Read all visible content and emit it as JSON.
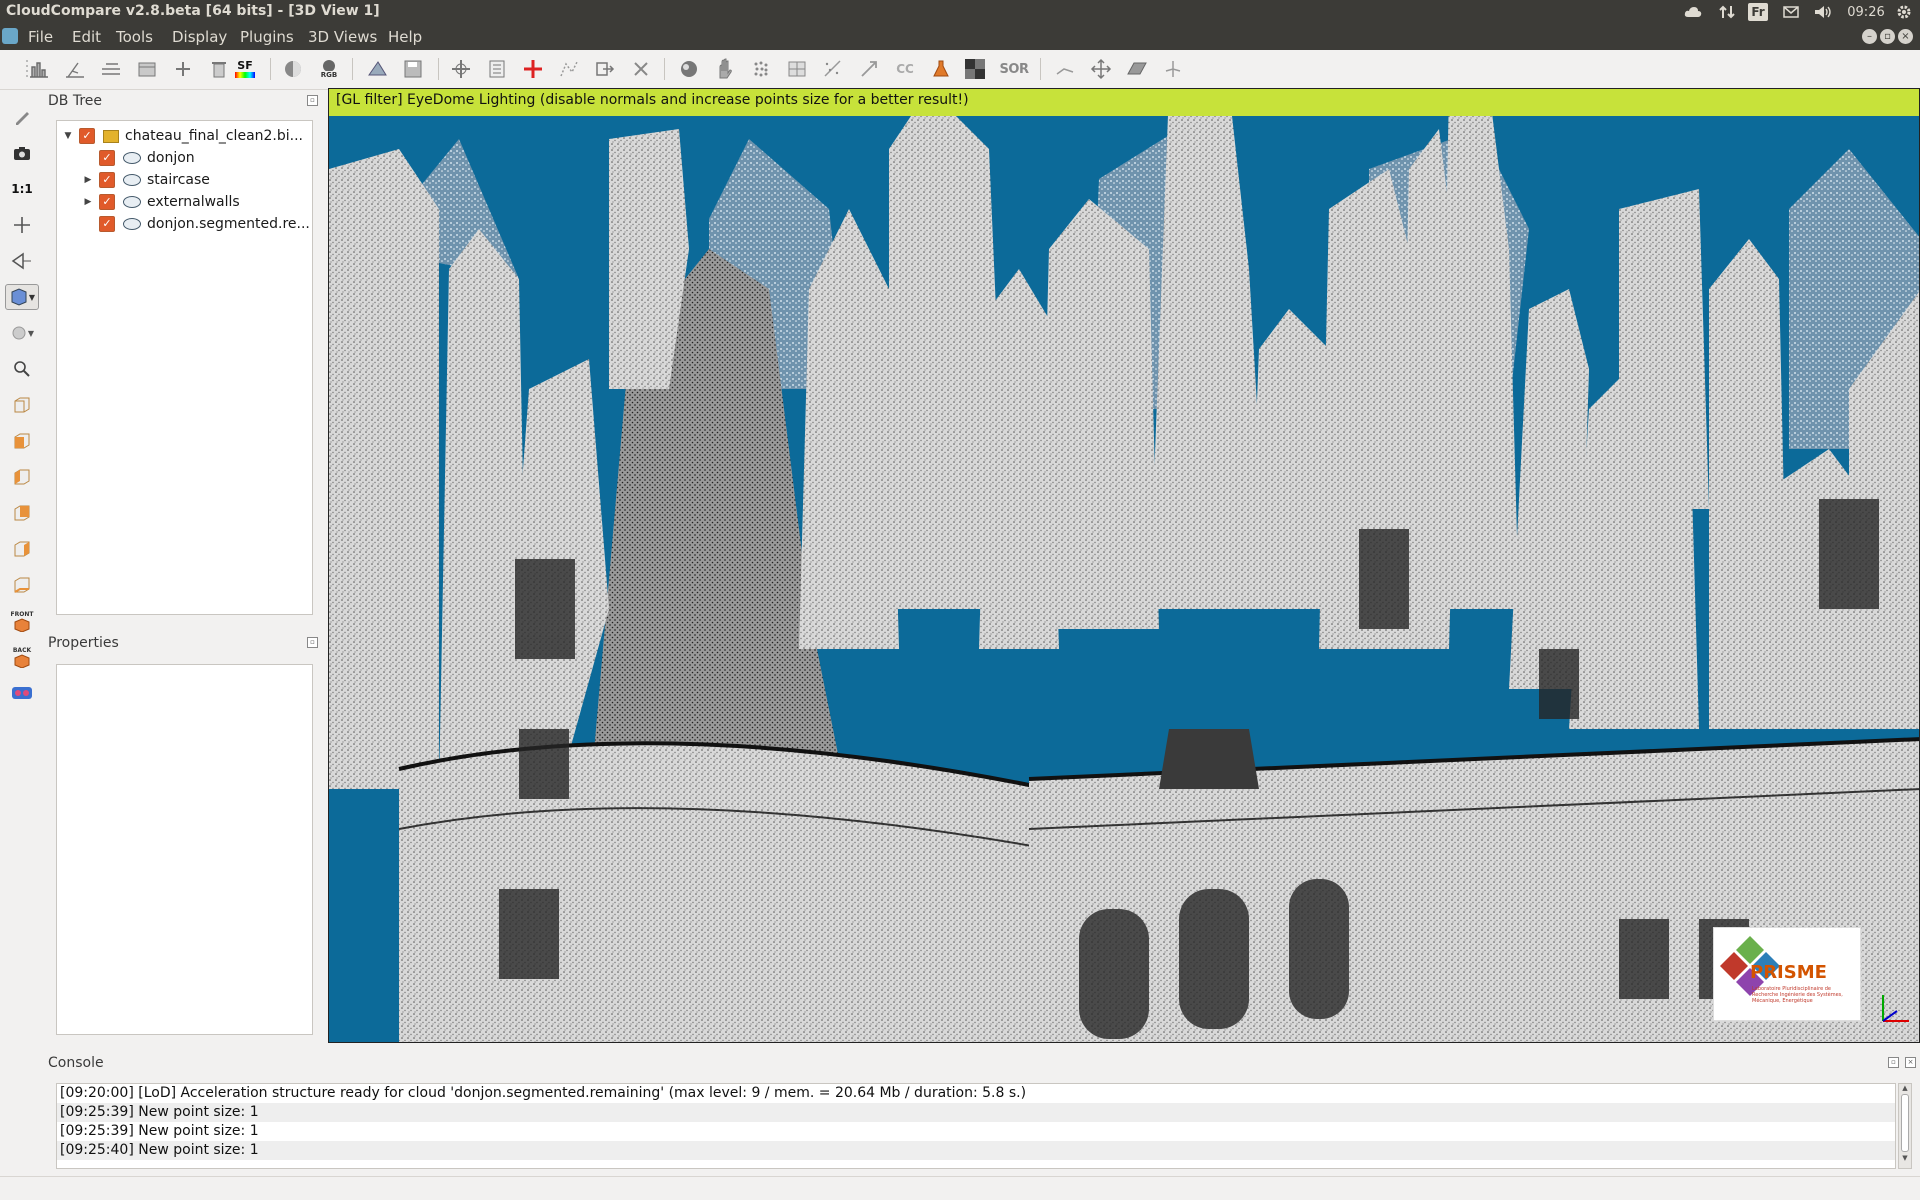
{
  "window": {
    "title": "CloudCompare v2.8.beta [64 bits] - [3D View 1]",
    "clock": "09:26",
    "keyboard_layout": "Fr",
    "tray_icons": [
      "cloud-icon",
      "network-arrows-icon",
      "keyboard-icon",
      "mail-icon",
      "volume-icon",
      "gear-icon"
    ]
  },
  "menu": {
    "items": [
      "File",
      "Edit",
      "Tools",
      "Display",
      "Plugins",
      "3D Views",
      "Help"
    ]
  },
  "toolbar": {
    "sf_label": "SF",
    "sor_label": "SOR",
    "cc_label": "CC",
    "rgb_label": "RGB"
  },
  "left_toolbar": {
    "ratio_label": "1:1",
    "front_label": "FRONT",
    "back_label": "BACK"
  },
  "db_tree": {
    "title": "DB Tree",
    "root": {
      "label": "chateau_final_clean2.bi..."
    },
    "children": [
      {
        "label": "donjon",
        "expandable": false
      },
      {
        "label": "staircase",
        "expandable": true
      },
      {
        "label": "externalwalls",
        "expandable": true
      },
      {
        "label": "donjon.segmented.re...",
        "expandable": false
      }
    ]
  },
  "properties": {
    "title": "Properties"
  },
  "view3d": {
    "banner": "[GL filter] EyeDome Lighting (disable normals and increase points size for a better result!)",
    "logo_text": "PRISME",
    "logo_subtext": "Laboratoire Pluridisciplinaire de Recherche Ingénierie des Systèmes, Mécanique, Energétique",
    "sky_color": "#0c6a99",
    "banner_color": "#c7e23a"
  },
  "console": {
    "title": "Console",
    "lines": [
      "[09:20:00] [LoD] Acceleration structure ready for cloud 'donjon.segmented.remaining' (max level: 9 / mem. = 20.64 Mb / duration: 5.8 s.)",
      "[09:25:39] New point size: 1",
      "[09:25:39] New point size: 1",
      "[09:25:40] New point size: 1"
    ]
  }
}
